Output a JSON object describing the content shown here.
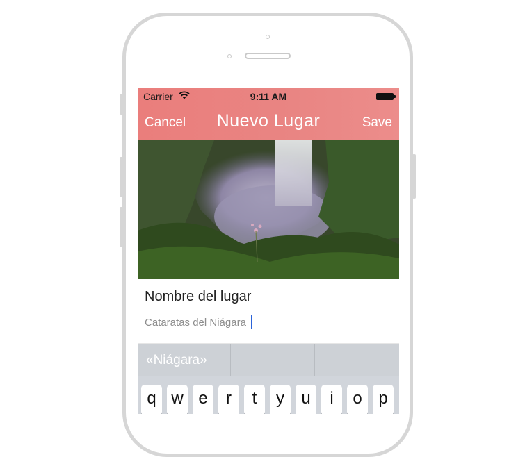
{
  "status": {
    "carrier": "Carrier",
    "time": "9:11 AM"
  },
  "nav": {
    "cancel": "Cancel",
    "title": "Nuevo Lugar",
    "save": "Save"
  },
  "form": {
    "label": "Nombre del lugar",
    "value": "Cataratas del Niágara"
  },
  "predictions": [
    "«Niágara»",
    "",
    ""
  ],
  "keyboard": {
    "row1": [
      "q",
      "w",
      "e",
      "r",
      "t",
      "y",
      "u",
      "i",
      "o",
      "p"
    ]
  },
  "colors": {
    "nav_bar": "#ea7e7c",
    "caret": "#2b63d9",
    "keyboard_bg": "#d1d5db"
  }
}
